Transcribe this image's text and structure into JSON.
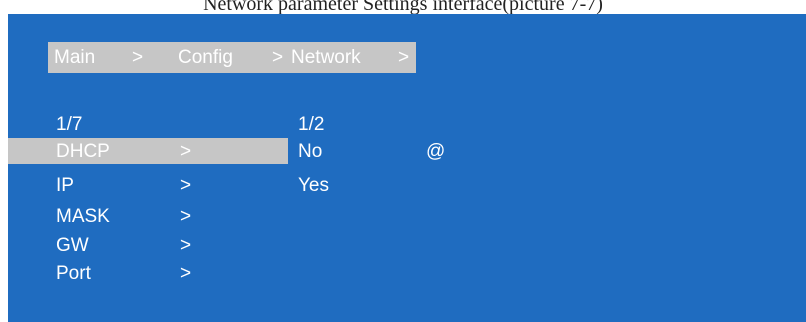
{
  "caption": "Network parameter Settings interface(picture 7-7)",
  "breadcrumb": {
    "main": "Main",
    "sep1": ">",
    "config": "Config",
    "sep2": ">",
    "network": "Network",
    "sep3": ">"
  },
  "menu": {
    "page_indicator": "1/7",
    "items": [
      {
        "label": "DHCP",
        "arrow": ">",
        "selected": true
      },
      {
        "label": "IP",
        "arrow": ">"
      },
      {
        "label": "MASK",
        "arrow": ">"
      },
      {
        "label": "GW",
        "arrow": ">"
      },
      {
        "label": "Port",
        "arrow": ">"
      }
    ]
  },
  "options": {
    "page_indicator": "1/2",
    "items": [
      {
        "label": "No",
        "marker": "@"
      },
      {
        "label": "Yes"
      }
    ]
  },
  "colors": {
    "background": "#1f6cc0",
    "highlight": "#c6c6c6",
    "text": "#ffffff"
  }
}
